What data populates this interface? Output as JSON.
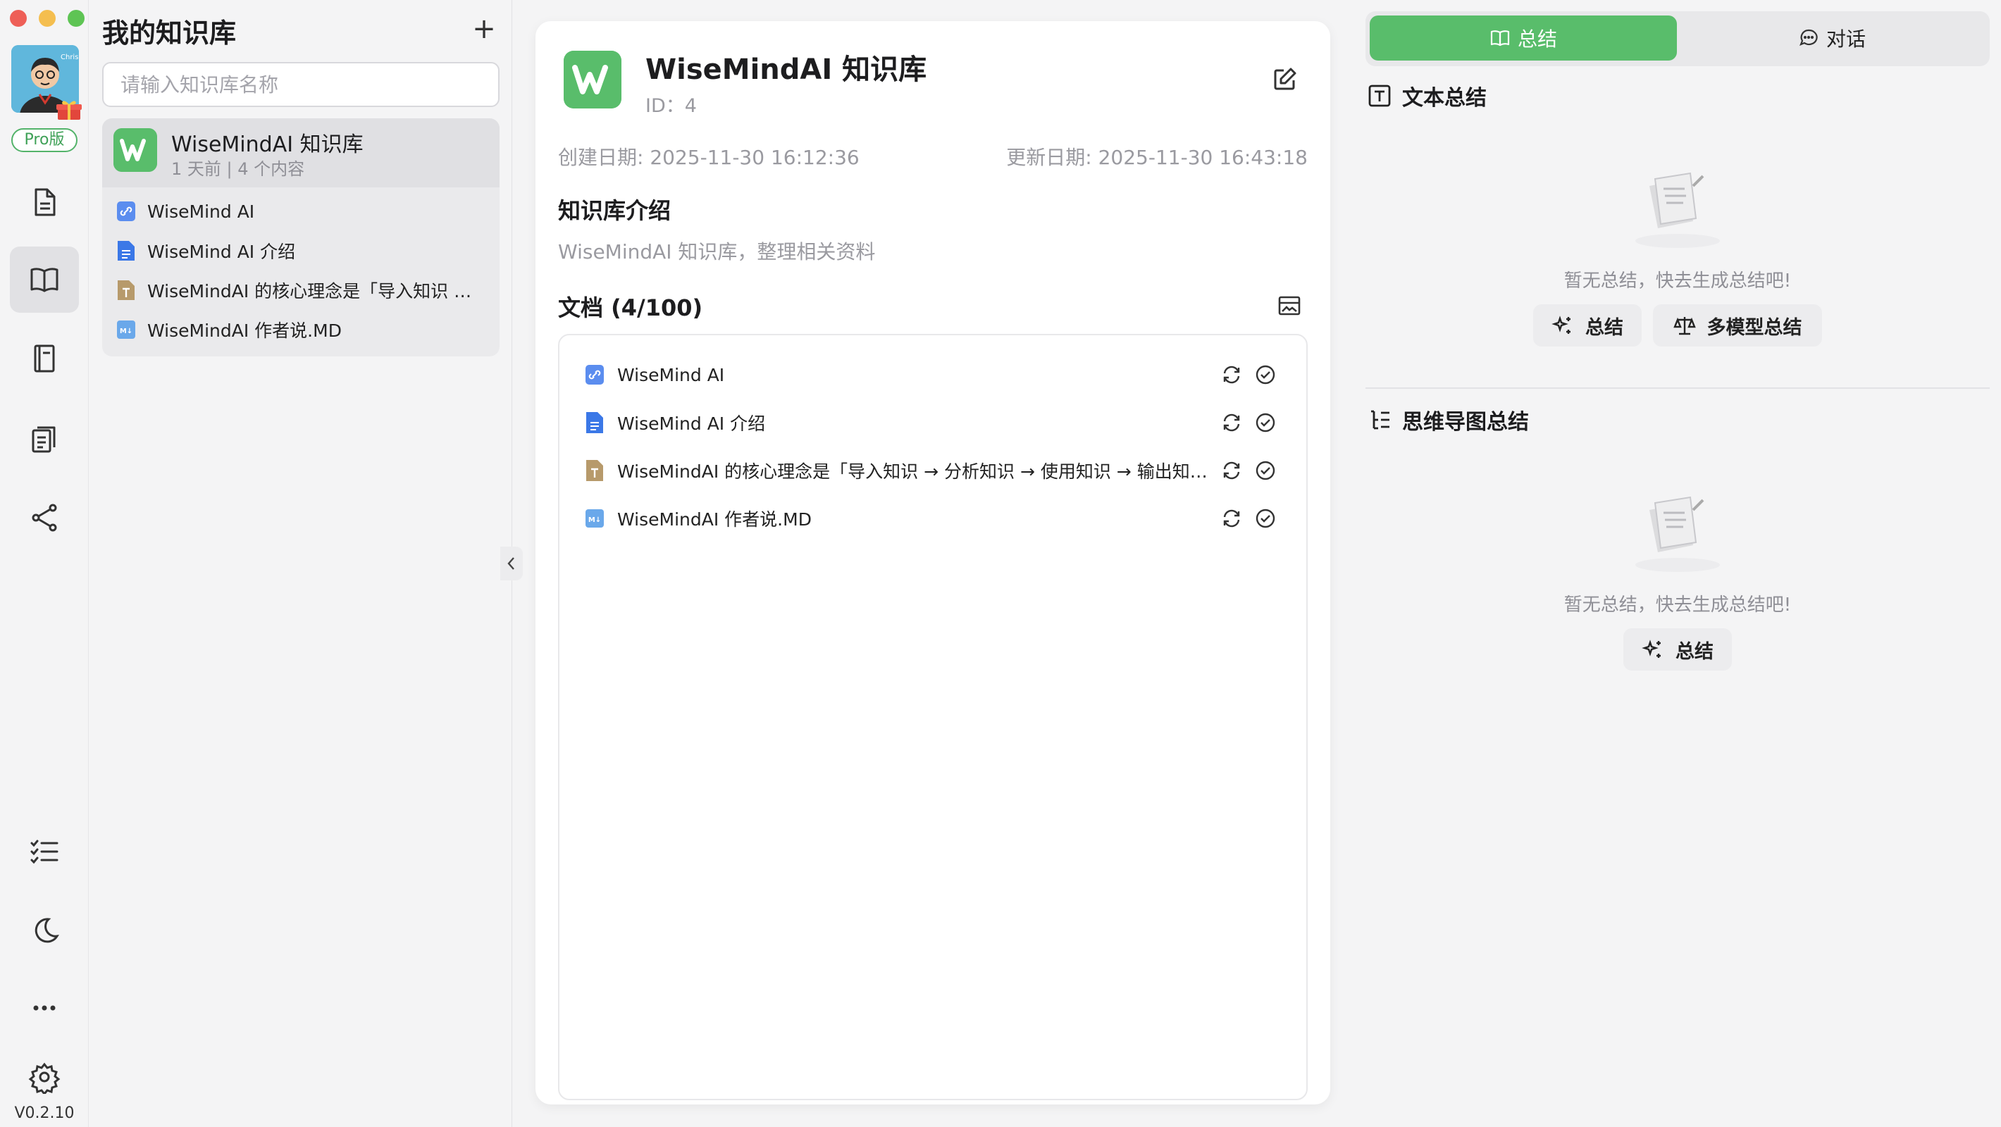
{
  "rail": {
    "pro_label": "Pro版",
    "version": "V0.2.10",
    "items": [
      "document-icon",
      "book-icon",
      "notebook-icon",
      "notes-icon",
      "share-icon",
      "checklist-icon",
      "moon-icon",
      "more-icon",
      "gear-icon"
    ]
  },
  "kb_panel": {
    "title": "我的知识库",
    "add_label": "+",
    "search_placeholder": "请输入知识库名称",
    "card": {
      "name": "WiseMindAI 知识库",
      "meta": "1 天前  |  4 个内容",
      "docs": [
        {
          "label": "WiseMind AI",
          "icon": "link-doc-icon"
        },
        {
          "label": "WiseMind AI 介绍",
          "icon": "google-doc-icon"
        },
        {
          "label": "WiseMindAI 的核心理念是「导入知识 → 分析知识 → 使用知识 → 输出知识」",
          "icon": "text-doc-icon"
        },
        {
          "label": "WiseMindAI 作者说.MD",
          "icon": "markdown-doc-icon"
        }
      ]
    }
  },
  "detail": {
    "name": "WiseMindAI 知识库",
    "id_text": "ID：4",
    "created": "创建日期: 2025-11-30 16:12:36",
    "updated": "更新日期: 2025-11-30 16:43:18",
    "intro_heading": "知识库介绍",
    "intro_text": "WiseMindAI 知识库，整理相关资料",
    "docs_heading": "文档 (4/100)",
    "docs": [
      {
        "label": "WiseMind AI"
      },
      {
        "label": "WiseMind AI 介绍"
      },
      {
        "label": "WiseMindAI 的核心理念是「导入知识 → 分析知识 → 使用知识 → 输出知识」"
      },
      {
        "label": "WiseMindAI 作者说.MD"
      }
    ]
  },
  "right": {
    "tab_summary": "总结",
    "tab_chat": "对话",
    "text_summary_heading": "文本总结",
    "empty_text_1": "暂无总结，快去生成总结吧!",
    "btn_summary": "总结",
    "btn_multi": "多模型总结",
    "mindmap_heading": "思维导图总结",
    "empty_text_2": "暂无总结，快去生成总结吧!",
    "btn_summary_2": "总结"
  },
  "colors": {
    "accent": "#59bd6b",
    "background": "#f4f4f5"
  }
}
